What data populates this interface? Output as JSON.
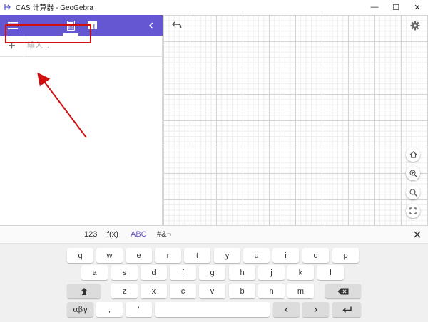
{
  "window": {
    "title": "CAS 计算器 - GeoGebra",
    "minimize": "—",
    "maximize": "☐",
    "close": "✕"
  },
  "algebra": {
    "add_symbol": "+",
    "input_placeholder": "输入..."
  },
  "keyboard": {
    "tabs": [
      {
        "label": "123",
        "active": false
      },
      {
        "label": "f(x)",
        "active": false
      },
      {
        "label": "ABC",
        "active": true
      },
      {
        "label": "#&¬",
        "active": false
      }
    ],
    "rows": [
      [
        "q",
        "w",
        "e",
        "r",
        "t",
        "y",
        "u",
        "i",
        "o",
        "p"
      ],
      [
        "a",
        "s",
        "d",
        "f",
        "g",
        "h",
        "j",
        "k",
        "l"
      ],
      [
        "z",
        "x",
        "c",
        "v",
        "b",
        "n",
        "m"
      ]
    ],
    "greek_key": "αβγ",
    "comma_key": ",",
    "quote_key": "'",
    "left_key": "‹",
    "right_key": "›"
  },
  "icons": {
    "menu": "hamburger-menu-icon",
    "calculator": "calculator-icon",
    "table": "table-icon",
    "collapse": "chevron-left-icon",
    "undo": "undo-icon",
    "settings": "gear-icon",
    "home": "home-icon",
    "zoom_in": "zoom-in-icon",
    "zoom_out": "zoom-out-icon",
    "fullscreen": "fullscreen-icon",
    "shift": "shift-icon",
    "backspace": "backspace-icon",
    "enter": "enter-icon"
  },
  "colors": {
    "accent": "#6557d2",
    "annotation": "#d01010"
  }
}
